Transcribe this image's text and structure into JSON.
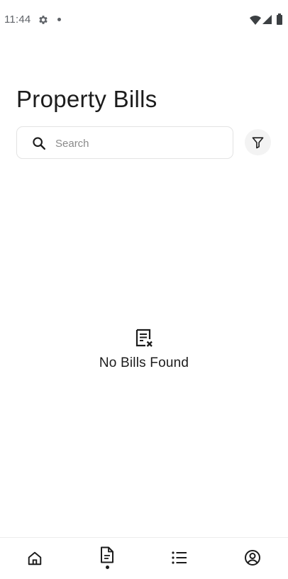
{
  "status_bar": {
    "time": "11:44",
    "icons": [
      "gear-icon",
      "dot-icon",
      "wifi-icon",
      "cell-signal-icon",
      "battery-icon"
    ]
  },
  "header": {
    "title": "Property Bills"
  },
  "search": {
    "placeholder": "Search",
    "value": ""
  },
  "filter": {
    "icon": "filter-icon"
  },
  "empty_state": {
    "icon": "document-x-icon",
    "message": "No Bills Found"
  },
  "bottom_nav": {
    "items": [
      {
        "icon": "home-icon",
        "active": false
      },
      {
        "icon": "document-icon",
        "active": true
      },
      {
        "icon": "list-icon",
        "active": false
      },
      {
        "icon": "profile-icon",
        "active": false
      }
    ]
  },
  "colors": {
    "text_primary": "#1c1c1c",
    "placeholder": "#8a8a8a",
    "border": "#e3e3e3",
    "filter_bg": "#f3f3f3",
    "status_gray": "#5f6368"
  }
}
